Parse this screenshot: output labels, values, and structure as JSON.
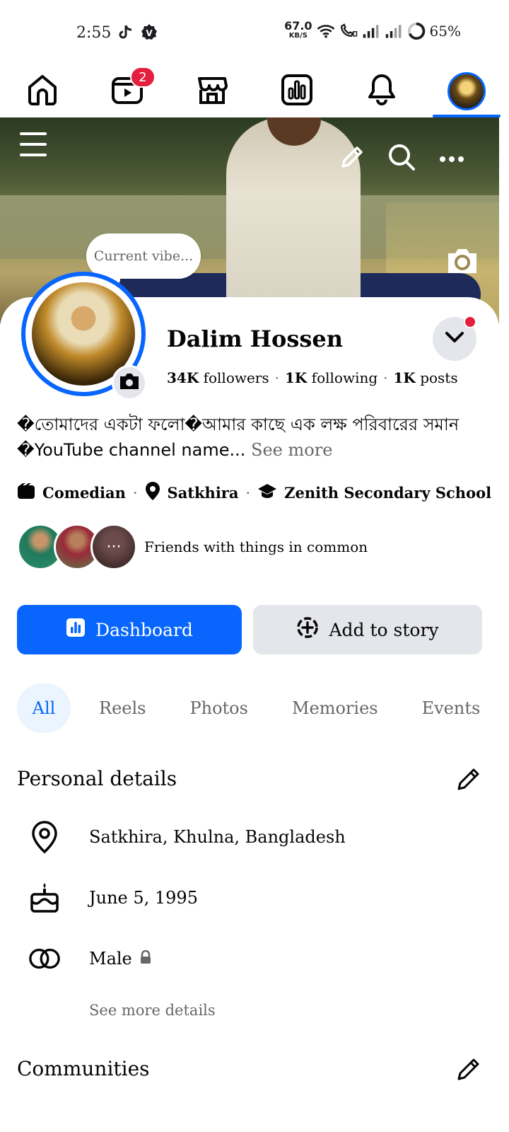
{
  "status_bar": {
    "time": "2:55",
    "net_speed": "67.0",
    "net_unit": "KB/S",
    "battery": "65%"
  },
  "nav": {
    "tabs": [
      {
        "name": "home",
        "icon": "home-icon"
      },
      {
        "name": "video",
        "icon": "video-icon",
        "badge": "2"
      },
      {
        "name": "marketplace",
        "icon": "marketplace-icon"
      },
      {
        "name": "dashboard",
        "icon": "dashboard-icon"
      },
      {
        "name": "notifications",
        "icon": "bell-icon"
      },
      {
        "name": "profile",
        "icon": "avatar",
        "active": true
      }
    ]
  },
  "cover": {
    "vibe_placeholder": "Current vibe..."
  },
  "profile": {
    "name": "Dalim Hossen",
    "followers_count": "34K",
    "followers_label": "followers",
    "following_count": "1K",
    "following_label": "following",
    "posts_count": "1K",
    "posts_label": "posts",
    "bio": "�তোমাদের একটা ফলো�আমার কাছে এক লক্ষ পরিবারের সমান �YouTube channel name...",
    "see_more": "See more",
    "intro": [
      {
        "icon": "clapperboard-icon",
        "label": "Comedian"
      },
      {
        "icon": "location-pin-icon",
        "label": "Satkhira"
      },
      {
        "icon": "graduation-cap-icon",
        "label": "Zenith Secondary School"
      }
    ],
    "friends_text": "Friends with things in common",
    "friends_more": "···"
  },
  "actions": {
    "dashboard": "Dashboard",
    "add_story": "Add to story"
  },
  "filters": [
    "All",
    "Reels",
    "Photos",
    "Memories",
    "Events"
  ],
  "personal_details": {
    "title": "Personal details",
    "location": "Satkhira, Khulna, Bangladesh",
    "birthday": "June 5, 1995",
    "gender": "Male",
    "see_more_details": "See more details"
  },
  "communities": {
    "title": "Communities"
  },
  "colors": {
    "accent": "#0866ff",
    "badge": "#e41e3f",
    "chip_bg": "#e4e6eb",
    "muted_text": "#65676b"
  }
}
